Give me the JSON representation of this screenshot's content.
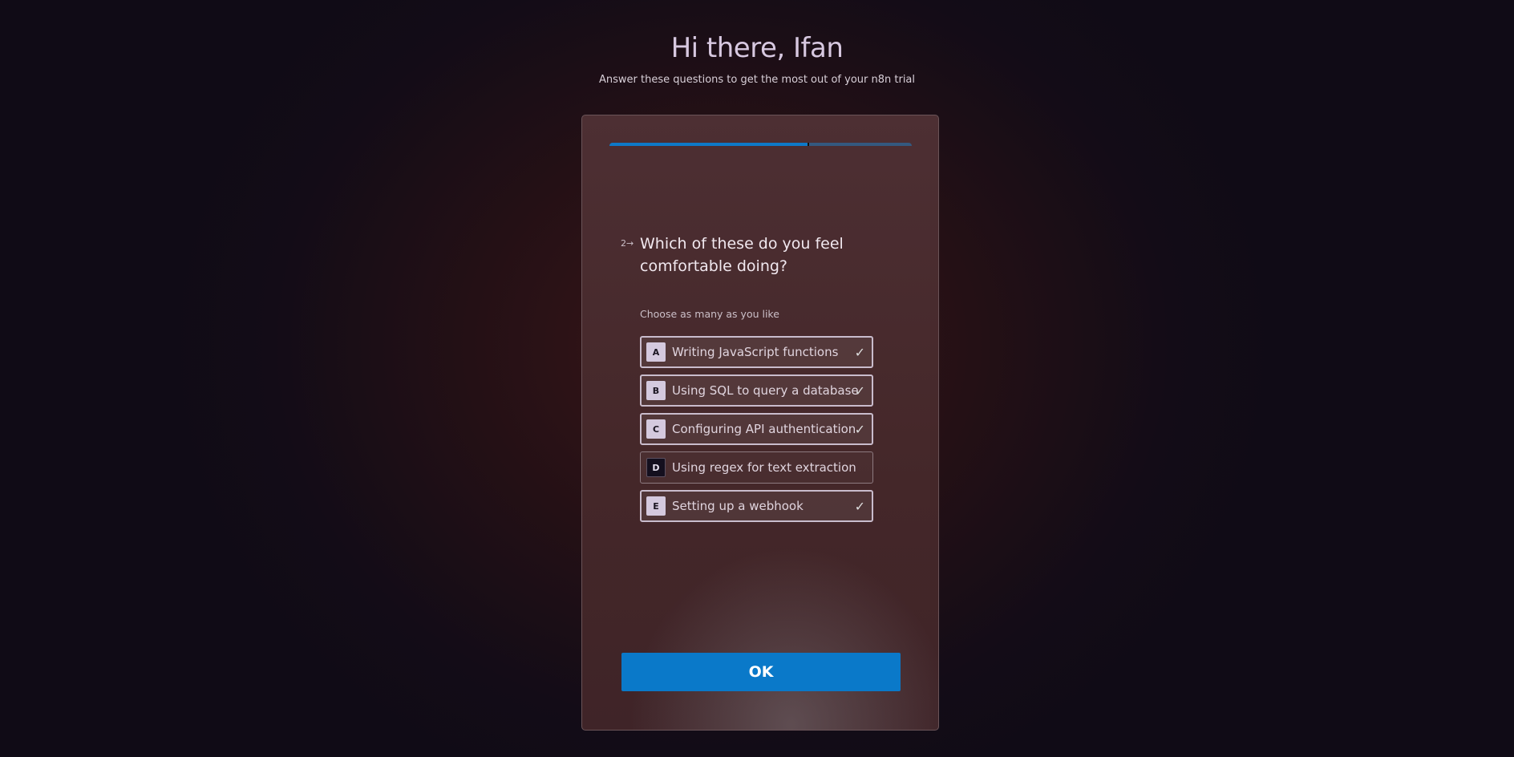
{
  "header": {
    "title": "Hi there, Ifan",
    "subtitle": "Answer these questions to get the most out of your n8n trial"
  },
  "progress": {
    "percent": 66,
    "color": "#0e79c8"
  },
  "question": {
    "number": "2→",
    "text": "Which of these do you feel comfortable doing?",
    "hint": "Choose as many as you like"
  },
  "options": [
    {
      "key": "A",
      "label": "Writing JavaScript functions",
      "selected": true
    },
    {
      "key": "B",
      "label": "Using SQL to query a database",
      "selected": true
    },
    {
      "key": "C",
      "label": "Configuring API authentication",
      "selected": true
    },
    {
      "key": "D",
      "label": "Using regex for text extraction",
      "selected": false
    },
    {
      "key": "E",
      "label": "Setting up a webhook",
      "selected": true
    }
  ],
  "ok_label": "OK"
}
